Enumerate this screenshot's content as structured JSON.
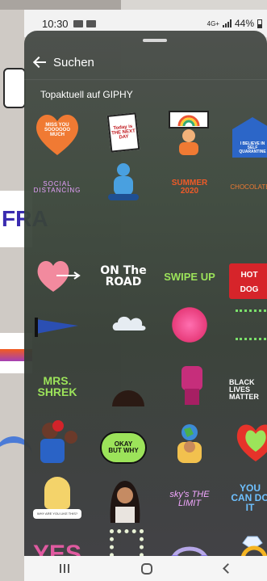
{
  "status_bar": {
    "time": "10:30",
    "network": "4G+",
    "battery": "44%"
  },
  "background_story": {
    "partial_text": "FRA"
  },
  "sheet": {
    "back_label": "Suchen",
    "section_title": "Topaktuell auf GIPHY"
  },
  "stickers": [
    {
      "id": "miss-you",
      "text": "MISS YOU SOOOOOO MUCH"
    },
    {
      "id": "today-next-day",
      "text": "Today is THE NEXT DAY"
    },
    {
      "id": "rainbow-person",
      "text": ""
    },
    {
      "id": "believe-self-quarantine",
      "text": "I BELIEVE IN SELF QUARANTINE"
    },
    {
      "id": "social-distancing",
      "text": "SOCIAL DISTANCING"
    },
    {
      "id": "blue-character",
      "text": ""
    },
    {
      "id": "summer-2020",
      "text": "SUMMER 2020"
    },
    {
      "id": "chocolate",
      "text": "CHOCOLATE"
    },
    {
      "id": "heart-arrow",
      "text": ""
    },
    {
      "id": "on-the-road",
      "text": "ON The ROAD"
    },
    {
      "id": "swipe-up",
      "text": "SWIPE UP"
    },
    {
      "id": "hot-dog",
      "text": "HOT DOG"
    },
    {
      "id": "pennant",
      "text": ""
    },
    {
      "id": "cloud",
      "text": ""
    },
    {
      "id": "pink-sparkle",
      "text": ""
    },
    {
      "id": "green-script",
      "text": ""
    },
    {
      "id": "mrs-shrek",
      "text": "MRS. SHREK"
    },
    {
      "id": "hair-peek",
      "text": ""
    },
    {
      "id": "fist",
      "text": ""
    },
    {
      "id": "black-lives-matter",
      "text": "BLACK LIVES MATTER"
    },
    {
      "id": "strong-woman",
      "text": ""
    },
    {
      "id": "okay-but-why",
      "text": "OKAY BUT WHY"
    },
    {
      "id": "earth-hands",
      "text": ""
    },
    {
      "id": "green-heart",
      "text": ""
    },
    {
      "id": "angel-why",
      "text": "WHY ARE YOU LIKE THIS?"
    },
    {
      "id": "woman-portrait",
      "text": ""
    },
    {
      "id": "sky-limit",
      "text": "sky's THE LIMIT"
    },
    {
      "id": "you-can-do-it",
      "text": "YOU CAN DO IT"
    },
    {
      "id": "yes",
      "text": "YES"
    },
    {
      "id": "flower-frame",
      "text": ""
    },
    {
      "id": "headphones",
      "text": ""
    },
    {
      "id": "ring",
      "text": ""
    }
  ],
  "colors": {
    "accent_orange": "#f07a33",
    "sheet_bg": "#3f4a3f"
  }
}
